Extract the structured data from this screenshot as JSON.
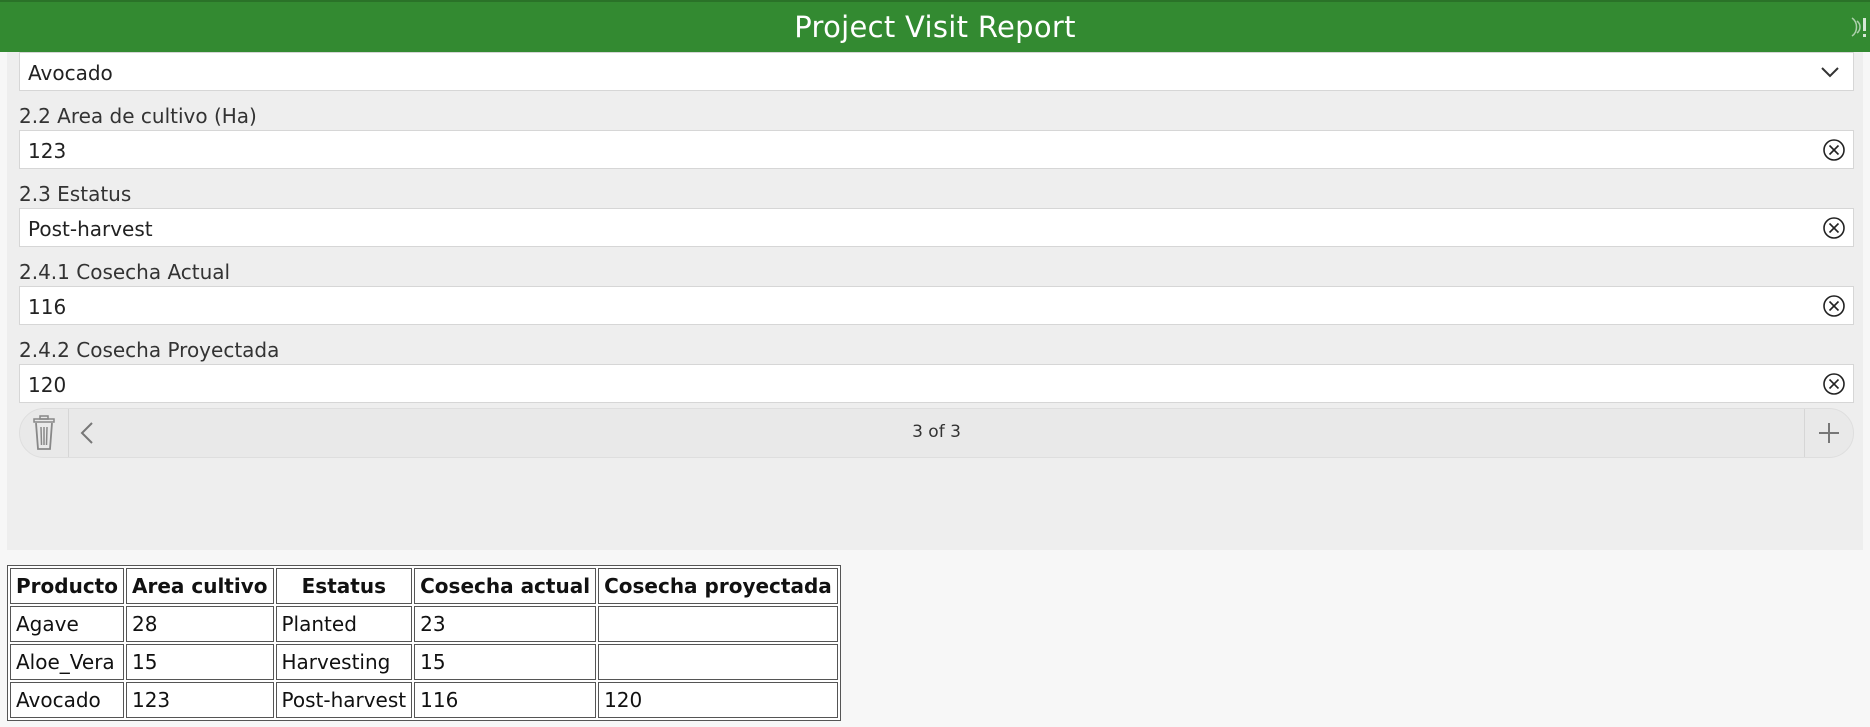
{
  "header": {
    "title": "Project Visit Report"
  },
  "form": {
    "product_select": {
      "value": "Avocado"
    },
    "area": {
      "label": "2.2 Area de cultivo (Ha)",
      "value": "123"
    },
    "status": {
      "label": "2.3 Estatus",
      "value": "Post-harvest"
    },
    "harvest_actual": {
      "label": "2.4.1 Cosecha Actual",
      "value": "116"
    },
    "harvest_projected": {
      "label": "2.4.2 Cosecha Proyectada",
      "value": "120"
    },
    "pager": {
      "text": "3 of 3"
    }
  },
  "table": {
    "headers": [
      "Producto",
      "Area cultivo",
      "Estatus",
      "Cosecha actual",
      "Cosecha proyectada"
    ],
    "rows": [
      [
        "Agave",
        "28",
        "Planted",
        "23",
        ""
      ],
      [
        "Aloe_Vera",
        "15",
        "Harvesting",
        "15",
        ""
      ],
      [
        "Avocado",
        "123",
        "Post-harvest",
        "116",
        "120"
      ]
    ]
  },
  "colors": {
    "header_green": "#338a31",
    "panel_gray": "#eeeeee"
  },
  "icons": [
    "chevron-down-icon",
    "clear-icon",
    "trash-icon",
    "chevron-left-icon",
    "plus-icon",
    "connectivity-icon"
  ]
}
